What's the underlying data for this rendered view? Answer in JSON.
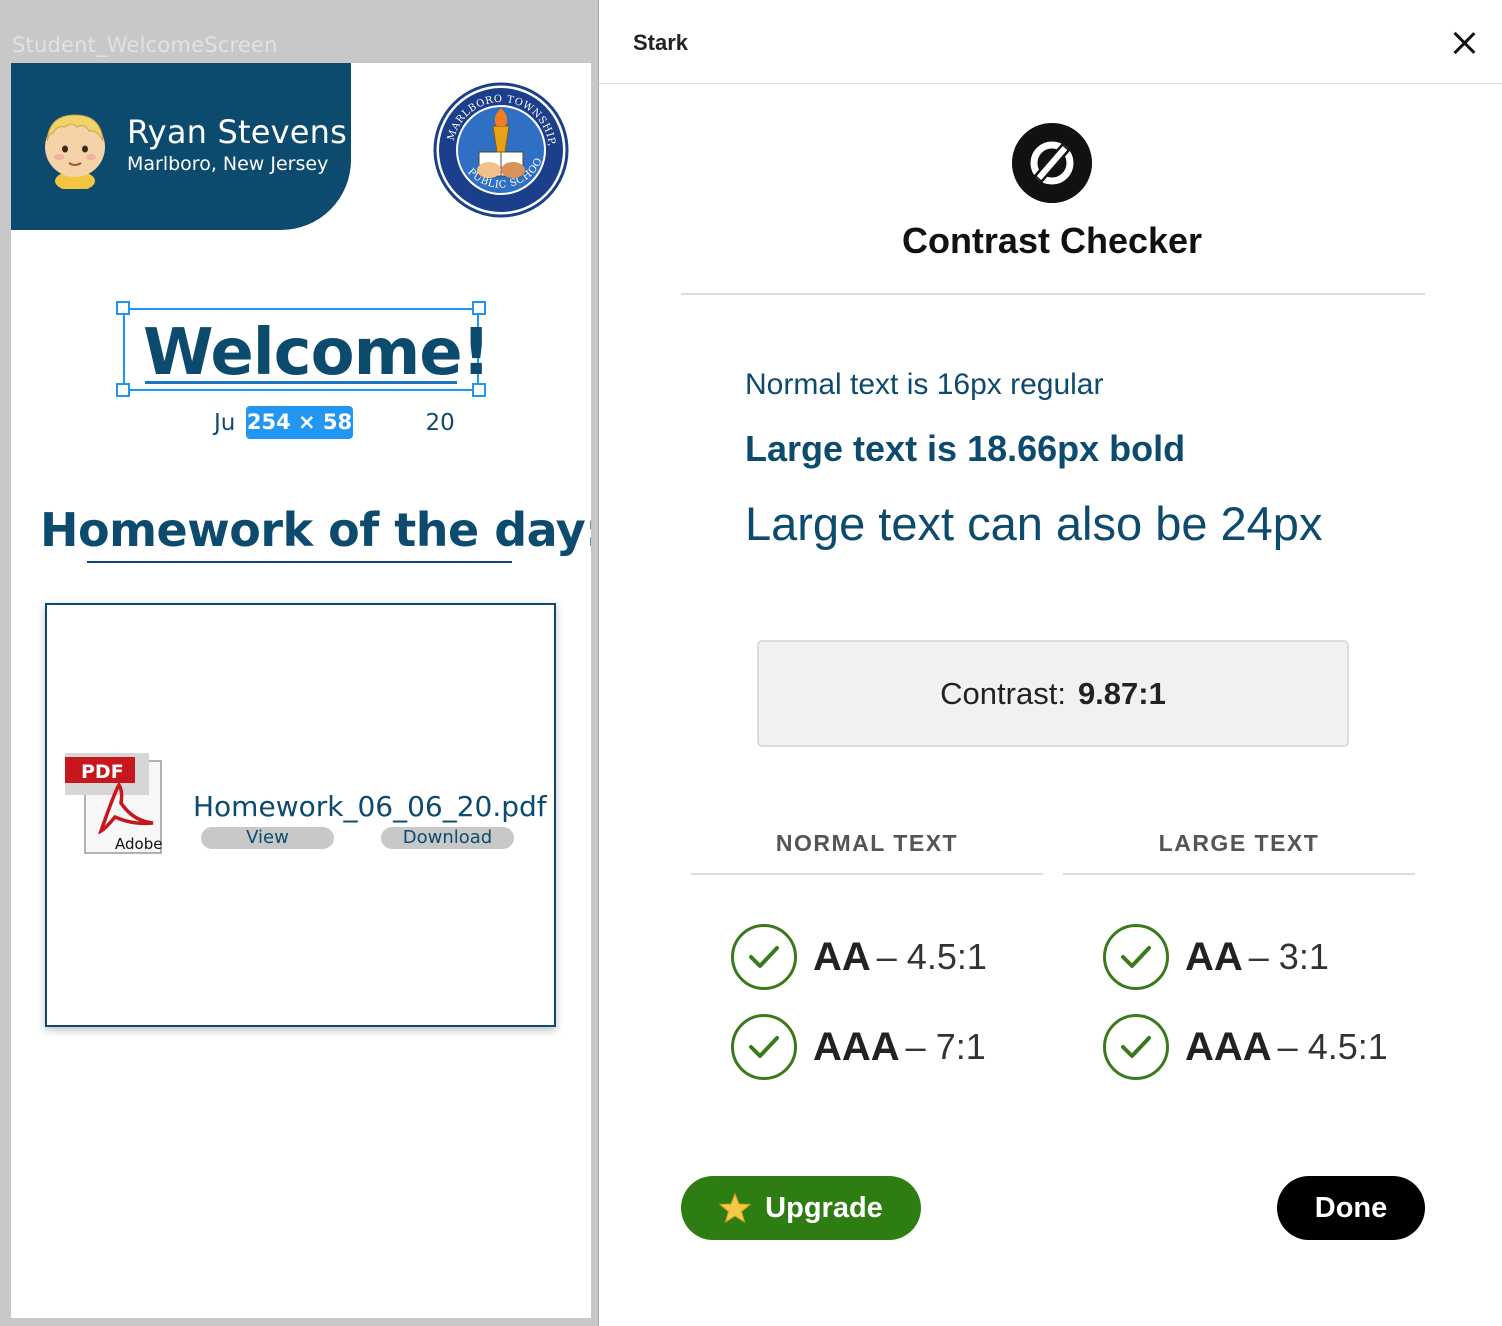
{
  "canvas": {
    "frame_label": "Student_WelcomeScreen"
  },
  "artboard": {
    "student": {
      "name": "Ryan Stevens",
      "location": "Marlboro, New Jersey"
    },
    "school_seal": {
      "text_top": "MARLBORO TOWNSHIP, NJ",
      "text_bottom": "PUBLIC SCHOOLS"
    },
    "welcome": "Welcome!",
    "date_visible": "Ju                          20",
    "selection_dimensions": "254 × 58",
    "homework_title": "Homework of the day:",
    "file": {
      "badge": "PDF",
      "brand": "Adobe",
      "name": "Homework_06_06_20.pdf",
      "view_label": "View",
      "download_label": "Download"
    }
  },
  "panel": {
    "title": "Stark",
    "checker_title": "Contrast Checker",
    "samples": {
      "normal": "Normal text is 16px regular",
      "large_bold": "Large text is 18.66px bold",
      "large": "Large text can also be 24px"
    },
    "contrast": {
      "label": "Contrast:",
      "value": "9.87:1"
    },
    "columns": {
      "normal": {
        "header": "NORMAL TEXT",
        "aa": {
          "level": "AA",
          "ratio": "– 4.5:1",
          "status": "pass"
        },
        "aaa": {
          "level": "AAA",
          "ratio": "– 7:1",
          "status": "pass"
        }
      },
      "large": {
        "header": "LARGE TEXT",
        "aa": {
          "level": "AA",
          "ratio": "– 3:1",
          "status": "pass"
        },
        "aaa": {
          "level": "AAA",
          "ratio": "– 4.5:1",
          "status": "pass"
        }
      }
    },
    "buttons": {
      "upgrade": "Upgrade",
      "done": "Done"
    }
  },
  "colors": {
    "brand_navy": "#0c4a6e",
    "selection_blue": "#2196f3",
    "pass_green": "#3a7a1a",
    "upgrade_green": "#2e7d12"
  }
}
